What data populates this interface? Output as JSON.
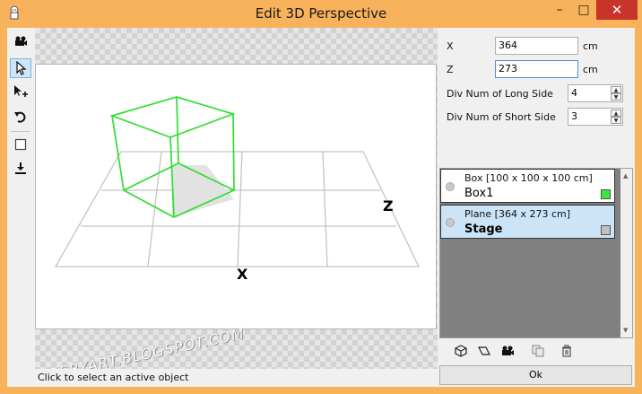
{
  "window": {
    "title": "Edit 3D Perspective",
    "min_glyph": "–",
    "max_glyph": "□",
    "close_glyph": "✕"
  },
  "toolbar": {
    "tools": [
      {
        "name": "camera-tool",
        "icon": "camera-icon"
      },
      {
        "name": "select-tool",
        "icon": "cursor-icon",
        "active": true
      },
      {
        "name": "move-tool",
        "icon": "move-cursor-icon"
      },
      {
        "name": "rotate-tool",
        "icon": "rotate-icon"
      },
      {
        "name": "plane-tool",
        "icon": "square-icon"
      },
      {
        "name": "ground-tool",
        "icon": "download-icon"
      }
    ]
  },
  "viewport": {
    "axis_x": "X",
    "axis_z": "Z"
  },
  "status": {
    "text": "Click to select an active object"
  },
  "watermark": {
    "text": "COSBYART.BLOGSPOT.COM"
  },
  "properties": {
    "x_label": "X",
    "x_value": "364",
    "x_unit": "cm",
    "z_label": "Z",
    "z_value": "273",
    "z_unit": "cm",
    "div_long_label": "Div Num of Long Side",
    "div_long_value": "4",
    "div_short_label": "Div Num of Short Side",
    "div_short_value": "3"
  },
  "objects": [
    {
      "sub": "Box [100 x 100 x 100 cm]",
      "name": "Box1",
      "swatch": "#3ce63c",
      "selected": false
    },
    {
      "sub": "Plane [364 x 273 cm]",
      "name": "Stage",
      "swatch": "#c0c0c0",
      "selected": true
    }
  ],
  "list_actions": [
    "box-add-icon",
    "plane-add-icon",
    "camera-icon",
    "duplicate-icon",
    "trash-icon"
  ],
  "ok_label": "Ok",
  "colors": {
    "titlebar": "#f8b25c",
    "box_wire": "#33dd33",
    "selection": "#cce4f7"
  }
}
